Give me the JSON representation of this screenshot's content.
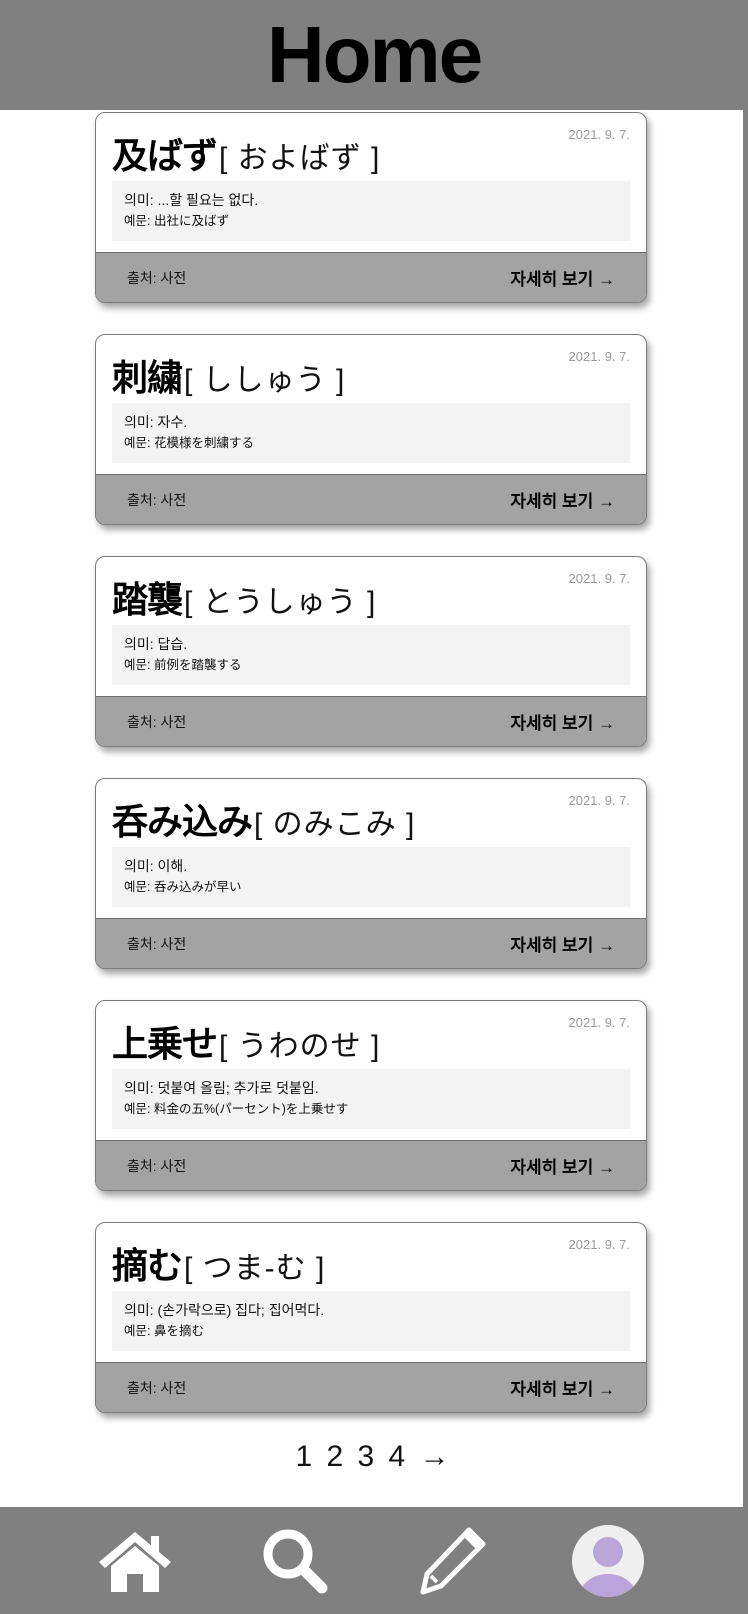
{
  "header": {
    "title": "Home"
  },
  "cards": [
    {
      "word": "及ばず",
      "reading": "[ およばず ]",
      "date": "2021. 9. 7.",
      "meaning": "의미: ...할 필요는 없다.",
      "example": "예문: 出社に及ばず",
      "source": "출처: 사전",
      "detail_label": "자세히 보기 →"
    },
    {
      "word": "刺繍",
      "reading": "[ ししゅう ]",
      "date": "2021. 9. 7.",
      "meaning": "의미: 자수.",
      "example": "예문: 花模様を刺繍する",
      "source": "출처: 사전",
      "detail_label": "자세히 보기 →"
    },
    {
      "word": "踏襲",
      "reading": "[ とうしゅう ]",
      "date": "2021. 9. 7.",
      "meaning": "의미: 답습.",
      "example": "예문: 前例を踏襲する",
      "source": "출처: 사전",
      "detail_label": "자세히 보기 →"
    },
    {
      "word": "呑み込み",
      "reading": "[ のみこみ ]",
      "date": "2021. 9. 7.",
      "meaning": "의미: 이해.",
      "example": "예문: 呑み込みが早い",
      "source": "출처: 사전",
      "detail_label": "자세히 보기 →"
    },
    {
      "word": "上乗せ",
      "reading": "[ うわのせ ]",
      "date": "2021. 9. 7.",
      "meaning": "의미: 덧붙여 올림; 추가로 덧붙임.",
      "example": "예문: 料金の五%(パーセント)を上乗せす",
      "source": "출처: 사전",
      "detail_label": "자세히 보기 →"
    },
    {
      "word": "摘む",
      "reading": "[ つま-む ]",
      "date": "2021. 9. 7.",
      "meaning": "의미: (손가락으로) 집다; 집어먹다.",
      "example": "예문: 鼻を摘む",
      "source": "출처: 사전",
      "detail_label": "자세히 보기 →"
    }
  ],
  "pagination": {
    "pages": [
      "1",
      "2",
      "3",
      "4"
    ],
    "next": "→"
  },
  "bottom_nav": [
    {
      "icon": "home-icon"
    },
    {
      "icon": "search-icon"
    },
    {
      "icon": "pencil-icon"
    },
    {
      "icon": "avatar-icon"
    }
  ],
  "colors": {
    "header_bg": "#808080",
    "card_footer_bg": "#a3a3a3",
    "desc_bg": "#f3f3f3",
    "avatar": "#b9a5d9"
  }
}
